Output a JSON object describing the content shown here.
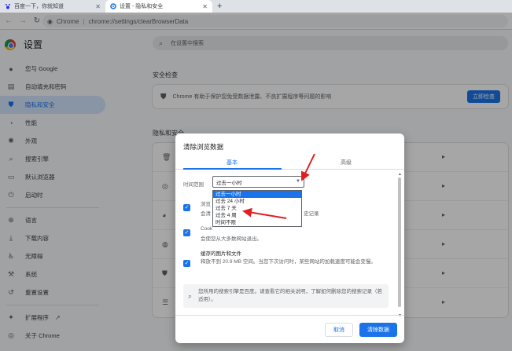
{
  "tabs": [
    {
      "title": "百度一下，你就知道"
    },
    {
      "title": "设置 - 隐私和安全"
    }
  ],
  "omnibox": {
    "scheme": "Chrome",
    "url": "chrome://settings/clearBrowserData"
  },
  "settings": {
    "title": "设置",
    "search_placeholder": "在设置中搜索",
    "sidebar": [
      {
        "label": "您与 Google",
        "icon": "person-icon"
      },
      {
        "label": "自动填充和密码",
        "icon": "autofill-icon"
      },
      {
        "label": "隐私和安全",
        "icon": "shield-icon",
        "active": true
      },
      {
        "label": "性能",
        "icon": "speedometer-icon"
      },
      {
        "label": "外观",
        "icon": "palette-icon"
      },
      {
        "label": "搜索引擎",
        "icon": "search-icon"
      },
      {
        "label": "默认浏览器",
        "icon": "browser-icon"
      },
      {
        "label": "启动时",
        "icon": "power-icon"
      },
      {
        "label": "语言",
        "icon": "globe-icon"
      },
      {
        "label": "下载内容",
        "icon": "download-icon"
      },
      {
        "label": "无障碍",
        "icon": "accessibility-icon"
      },
      {
        "label": "系统",
        "icon": "wrench-icon"
      },
      {
        "label": "重置设置",
        "icon": "reset-icon"
      },
      {
        "label": "扩展程序",
        "icon": "puzzle-icon"
      },
      {
        "label": "关于 Chrome",
        "icon": "chrome-icon"
      }
    ],
    "safety_check": {
      "title": "安全检查",
      "text": "Chrome 有助于保护您免受数据泄露、不良扩展程序等问题的影响",
      "button": "立即检查"
    },
    "privacy_title": "隐私和安全"
  },
  "dialog": {
    "title": "清除浏览数据",
    "tab_basic": "基本",
    "tab_advanced": "高级",
    "time_range_label": "时间范围",
    "time_range_value": "过去一小时",
    "dropdown_options": [
      "过去一小时",
      "过去 24 小时",
      "过去 7 天",
      "过去 4 周",
      "时间不限"
    ],
    "dropdown_selected_index": 0,
    "options": [
      {
        "title": "浏览记录",
        "desc": "会清除所有已登录设备上的历史记录",
        "checked": true,
        "title_peek": "浏览",
        "desc_lead": "会清",
        "desc_peek": "史记录"
      },
      {
        "title": "Cookie 及其他网站数据",
        "desc": "会使您从大多数网站退出。",
        "checked": true,
        "title_peek": "Cook"
      },
      {
        "title": "缓存的图片和文件",
        "desc": "释放不到 20.9 MB 空间。当您下次访问时，某些网站的加载速度可能会变慢。",
        "checked": true
      }
    ],
    "notice": "您所用的搜索引擎是百度。请查看它的相关说明，了解如何删除您的搜索记录（若适用）。",
    "cancel": "取消",
    "clear": "清除数据"
  }
}
